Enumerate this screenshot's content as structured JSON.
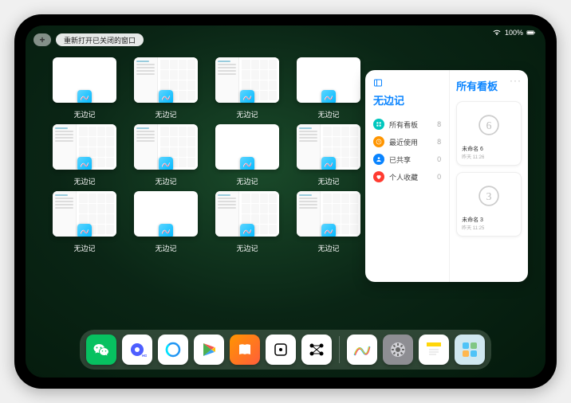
{
  "status": {
    "battery": "100%"
  },
  "topbar": {
    "add_label": "+",
    "reopen_label": "重新打开已关闭的窗口"
  },
  "app": {
    "name": "无边记"
  },
  "windows": [
    {
      "label": "无边记",
      "variant": "blank"
    },
    {
      "label": "无边记",
      "variant": "split"
    },
    {
      "label": "无边记",
      "variant": "split"
    },
    {
      "label": "无边记",
      "variant": "blank"
    },
    {
      "label": "无边记",
      "variant": "split"
    },
    {
      "label": "无边记",
      "variant": "split"
    },
    {
      "label": "无边记",
      "variant": "blank"
    },
    {
      "label": "无边记",
      "variant": "split"
    },
    {
      "label": "无边记",
      "variant": "split"
    },
    {
      "label": "无边记",
      "variant": "blank"
    },
    {
      "label": "无边记",
      "variant": "split"
    },
    {
      "label": "无边记",
      "variant": "split"
    }
  ],
  "widget": {
    "left_title": "无边记",
    "right_title": "所有看板",
    "items": [
      {
        "icon": "grid",
        "color": "#00c7be",
        "label": "所有看板",
        "count": "8"
      },
      {
        "icon": "clock",
        "color": "#ff9500",
        "label": "最近使用",
        "count": "8"
      },
      {
        "icon": "person",
        "color": "#0a84ff",
        "label": "已共享",
        "count": "0"
      },
      {
        "icon": "heart",
        "color": "#ff3b30",
        "label": "个人收藏",
        "count": "0"
      }
    ],
    "boards": [
      {
        "glyph": "6",
        "name": "未命名 6",
        "sub": "昨天 11:26"
      },
      {
        "glyph": "3",
        "name": "未命名 3",
        "sub": "昨天 11:25"
      }
    ]
  },
  "dock": [
    {
      "name": "wechat",
      "bg": "#07c160"
    },
    {
      "name": "quark",
      "bg": "#ffffff"
    },
    {
      "name": "qqbrowser",
      "bg": "#ffffff"
    },
    {
      "name": "play",
      "bg": "#ffffff"
    },
    {
      "name": "books",
      "bg": "linear-gradient(135deg,#ff9500,#ff5e3a)"
    },
    {
      "name": "dice",
      "bg": "#ffffff"
    },
    {
      "name": "network",
      "bg": "#ffffff"
    },
    {
      "name": "freeform",
      "bg": "#ffffff"
    },
    {
      "name": "settings",
      "bg": "#8e8e93"
    },
    {
      "name": "notes",
      "bg": "#ffffff"
    },
    {
      "name": "widgets",
      "bg": "#d0e8f0"
    }
  ]
}
